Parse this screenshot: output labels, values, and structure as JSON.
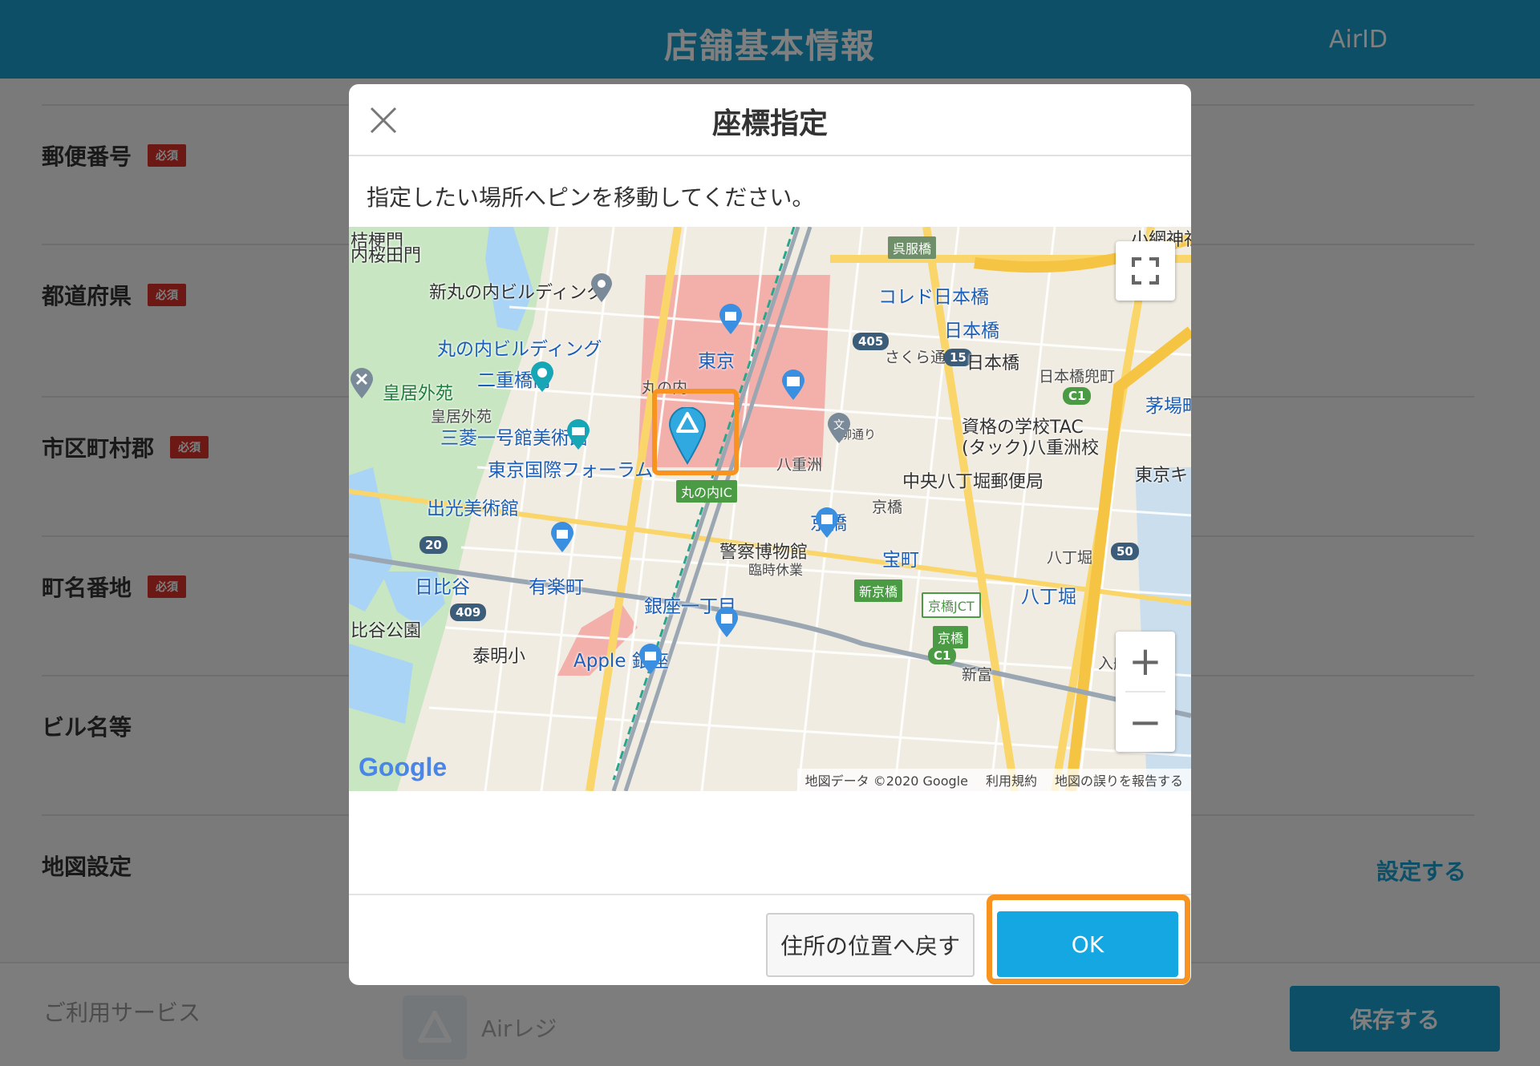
{
  "header": {
    "title": "店舗基本情報",
    "account": "AirID"
  },
  "form": {
    "required_badge": "必須",
    "rows": [
      {
        "label": "郵便番号"
      },
      {
        "label": "都道府県"
      },
      {
        "label": "市区町村郡"
      },
      {
        "label": "町名番地"
      },
      {
        "label": "ビル名等"
      },
      {
        "label": "地図設定",
        "action": "設定する"
      }
    ]
  },
  "footer": {
    "service_label": "ご利用サービス",
    "service_name": "Airレジ",
    "save_label": "保存する"
  },
  "modal": {
    "title": "座標指定",
    "instruction": "指定したい場所へピンを移動してください。",
    "reset_label": "住所の位置へ戻す",
    "ok_label": "OK"
  },
  "map": {
    "attribution": {
      "data": "地図データ ©2020 Google",
      "terms": "利用規約",
      "report": "地図の誤りを報告する"
    },
    "logo": "Google",
    "controls": {
      "zoom_in": "+",
      "zoom_out": "−"
    },
    "labels": {
      "kikyomon": "桔梗門",
      "uchisakurada": "内桜田門",
      "shinmaru": "新丸の内ビルディング",
      "gofukubashi": "呉服橋",
      "kobiki": "小網神社",
      "coredo": "コレド日本橋",
      "maru_bldg": "丸の内ビルディング",
      "nihonbashi_st": "日本橋",
      "tokyo_st": "東京",
      "sakura_dori": "さくら通り",
      "nihonbashi": "日本橋",
      "nijubashimae": "二重橋前",
      "nihonbashi_kabuto": "日本橋兜町",
      "kokyo_gaien": "皇居外苑",
      "kokyo_gaien_small": "皇居外苑",
      "kayabacho": "茅場町",
      "marunouchi": "丸の内",
      "mitsubishi": "三菱一号館美術館",
      "tac": "資格の学校TAC",
      "tac2": "(タック)八重洲校",
      "yaesu": "八重洲",
      "yanagi_dori": "柳通り",
      "forum": "東京国際フォーラム",
      "chuo_hatchobori": "中央八丁堀郵便局",
      "tokyo_kiku": "東京キ",
      "marunouchi_ic": "丸の内IC",
      "idemitsu": "出光美術館",
      "kyobashi_small": "京橋",
      "kyobashi": "京橋",
      "police": "警察博物館",
      "rinji": "臨時休業",
      "hachobori_small": "八丁堀",
      "takaracho": "宝町",
      "hibiya": "日比谷",
      "yurakucho": "有楽町",
      "ginza1": "銀座一丁目",
      "shinkyobashi": "新京橋",
      "kyobashi_jct": "京橋JCT",
      "hachobori": "八丁堀",
      "hibiya_koen": "比谷公園",
      "kyobashi_green": "京橋",
      "taimei": "泰明小",
      "apple": "Apple 銀座",
      "iriai": "入船",
      "shintomi": "新富",
      "route_405": "405",
      "route_15": "15",
      "route_20": "20",
      "route_50": "50",
      "route_409": "409",
      "route_c1a": "C1",
      "route_c1b": "C1"
    }
  },
  "colors": {
    "brand": "#1b9fcf",
    "ok": "#14a7e2",
    "highlight": "#f7931e",
    "required": "#d9302b"
  }
}
